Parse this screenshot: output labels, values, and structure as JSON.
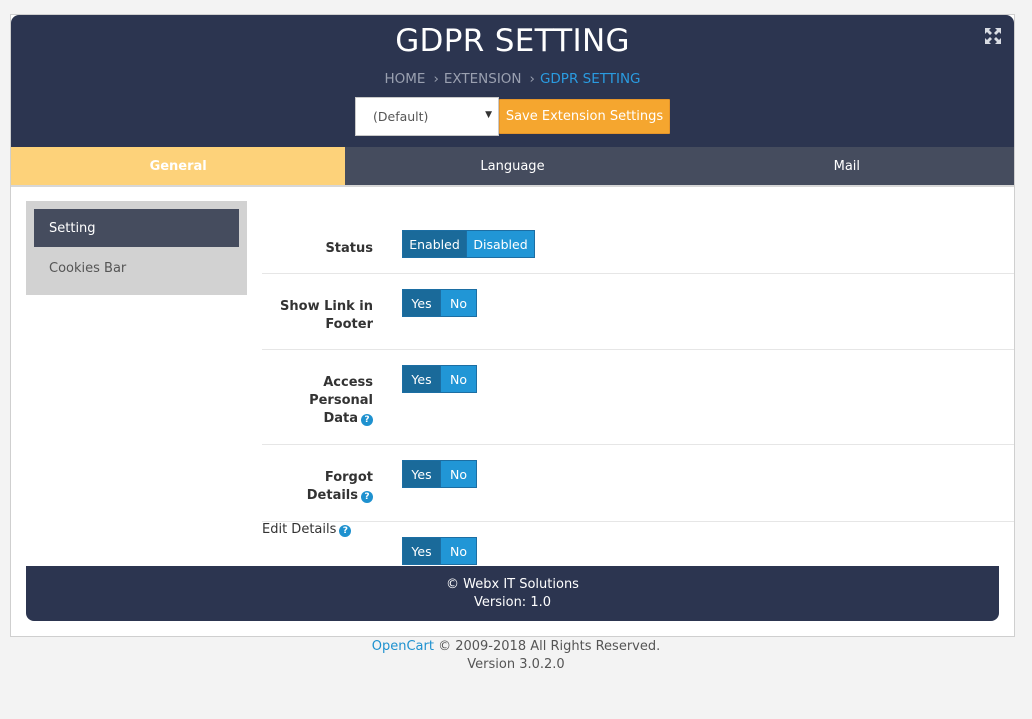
{
  "header": {
    "title": "GDPR SETTING",
    "breadcrumb": [
      "HOME",
      "EXTENSION",
      "GDPR SETTING"
    ],
    "breadcrumb_separator": "›",
    "store_select_value": "(Default)",
    "save_label": "Save Extension Settings"
  },
  "tabs": [
    {
      "label": "General",
      "active": true
    },
    {
      "label": "Language",
      "active": false
    },
    {
      "label": "Mail",
      "active": false
    }
  ],
  "sidebar": {
    "items": [
      {
        "label": "Setting",
        "active": true
      },
      {
        "label": "Cookies Bar",
        "active": false
      }
    ]
  },
  "form": {
    "status": {
      "label": "Status",
      "on": "Enabled",
      "off": "Disabled"
    },
    "show_link_footer": {
      "label_line1": "Show Link in",
      "label_line2": "Footer",
      "on": "Yes",
      "off": "No"
    },
    "access_personal_data": {
      "label_line1": "Access",
      "label_line2": "Personal",
      "label_line3": "Data",
      "on": "Yes",
      "off": "No"
    },
    "forgot_details": {
      "label_line1": "Forgot",
      "label_line2": "Details",
      "on": "Yes",
      "off": "No"
    },
    "edit_details": {
      "label": "Edit Details",
      "on": "Yes",
      "off": "No"
    },
    "help_glyph": "?"
  },
  "module_footer": {
    "line1": "© Webx IT Solutions",
    "line2": "Version: 1.0"
  },
  "page_footer": {
    "link": "OpenCart",
    "copyright": "© 2009-2018 All Rights Reserved.",
    "version": "Version 3.0.2.0"
  },
  "colors": {
    "header_bg": "#2c3550",
    "accent_orange": "#f5a62f",
    "active_tab": "#fdd27a",
    "toggle_on": "#1a6a9a",
    "toggle_off": "#2196d6",
    "link_blue": "#1e91cf"
  }
}
